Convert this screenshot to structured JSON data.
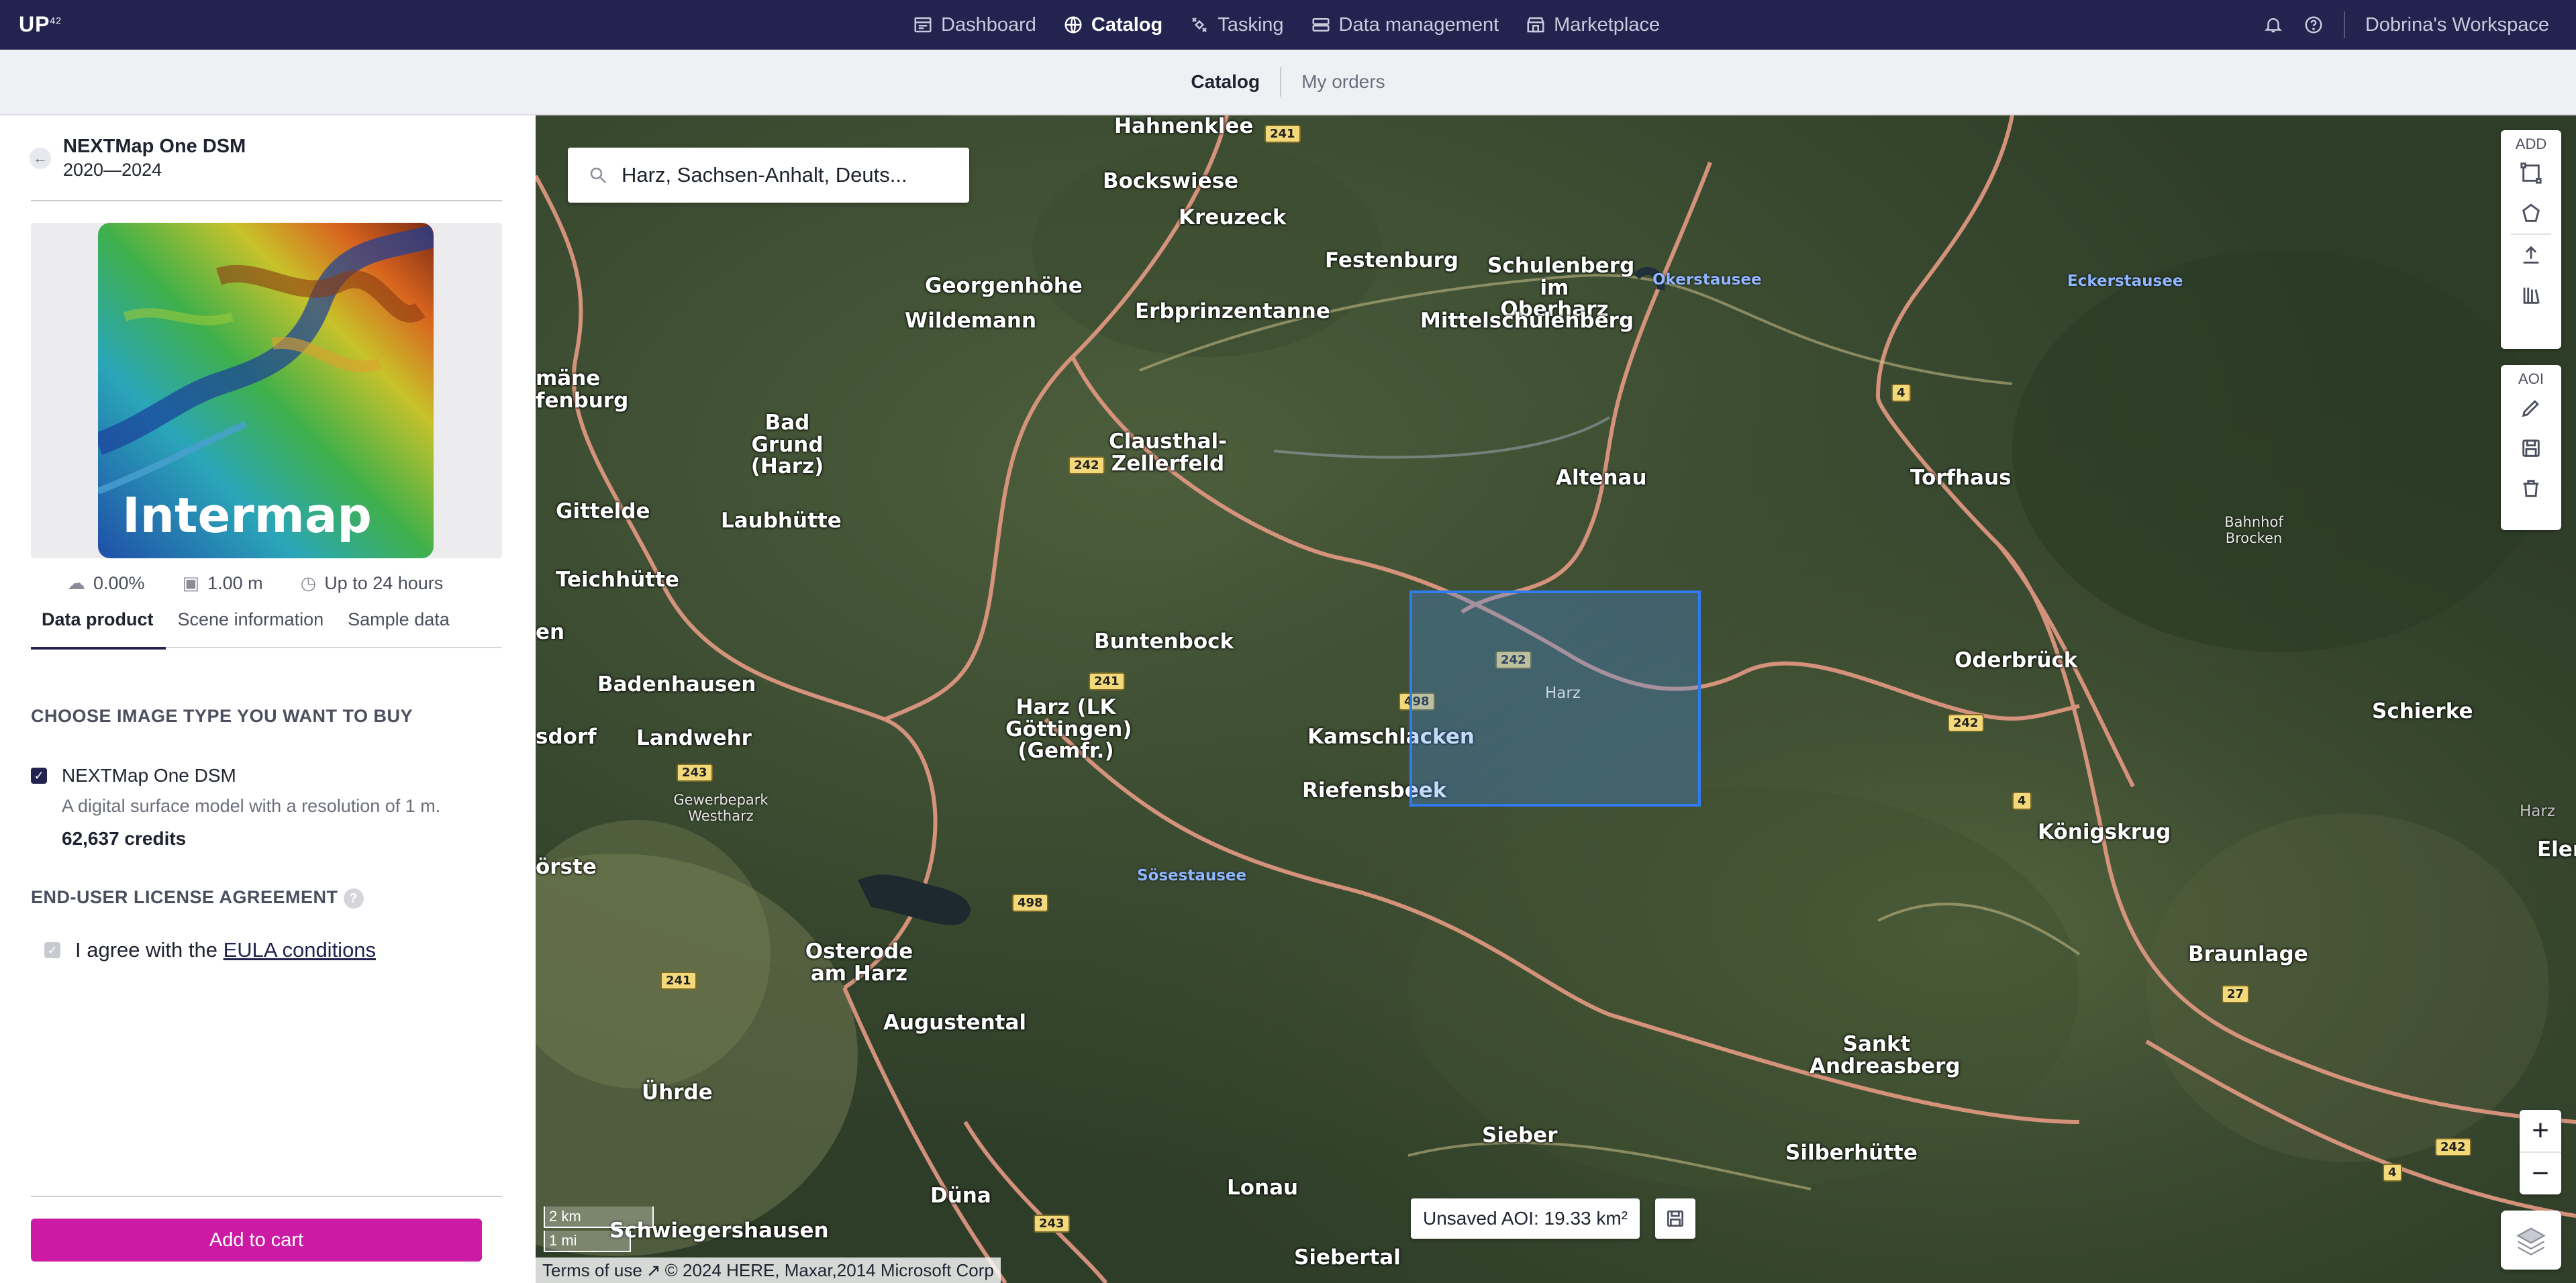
{
  "topbar": {
    "logo": "UP",
    "logo_sup": "42",
    "nav": [
      {
        "label": "Dashboard",
        "icon": "dashboard-icon"
      },
      {
        "label": "Catalog",
        "icon": "globe-icon",
        "active": true
      },
      {
        "label": "Tasking",
        "icon": "satellite-icon"
      },
      {
        "label": "Data management",
        "icon": "storage-icon"
      },
      {
        "label": "Marketplace",
        "icon": "store-icon"
      }
    ],
    "workspace": "Dobrina's Workspace"
  },
  "subnav": {
    "catalog": "Catalog",
    "orders": "My orders"
  },
  "panel": {
    "title": "NEXTMap One DSM",
    "years": "2020—2024",
    "thumb_label": "Intermap",
    "meta": {
      "cloud": "0.00%",
      "resolution": "1.00 m",
      "delivery": "Up to 24 hours"
    },
    "tabs": [
      "Data product",
      "Scene information",
      "Sample data"
    ],
    "choose_heading": "CHOOSE IMAGE TYPE YOU WANT TO BUY",
    "product_name": "NEXTMap One DSM",
    "product_desc": "A digital surface model with a resolution of 1 m.",
    "credits": "62,637 credits",
    "eula_heading": "END-USER LICENSE AGREEMENT",
    "eula_help": "?",
    "eula_prefix": "I agree with the ",
    "eula_link": "EULA conditions",
    "add_to_cart": "Add to cart"
  },
  "map": {
    "search_value": "Harz, Sachsen-Anhalt, Deuts...",
    "tools": {
      "add_label": "ADD",
      "aoi_label": "AOI"
    },
    "zoom_in": "+",
    "zoom_out": "−",
    "aoi_badge": "Unsaved AOI: 19.33 km²",
    "scale_km": "2 km",
    "scale_mi": "1 mi",
    "attribution_terms": "Terms of use",
    "attribution_text": "© 2024 HERE, Maxar,2014 Microsoft Corp",
    "aoi_name": "Harz",
    "places": [
      "Hahnenklee",
      "Bockswiese",
      "Kreuzeck",
      "Georgenhöhe",
      "Wildemann",
      "Festenburg",
      "Erbprinzentanne",
      "Schulenberg im Oberharz",
      "Mittelschulenberg",
      "Bad Grund (Harz)",
      "Clausthal-Zellerfeld",
      "Altenau",
      "Torfhaus",
      "Gittelde",
      "Laubhütte",
      "Teichhütte",
      "Buntenbock",
      "Oderbrück",
      "Schierke",
      "Badenhausen",
      "Harz (LK Göttingen) (Gemfr.)",
      "Kamschlacken",
      "Landwehr",
      "Riefensbeek",
      "Königskrug",
      "Elend",
      "Osterode am Harz",
      "Augustental",
      "Braunlage",
      "Sankt Andreasberg",
      "Ührde",
      "Sieber",
      "Silberhütte",
      "Lonau",
      "Düna",
      "Schwiegershausen",
      "Siebertal",
      "mäne fenburg",
      "sdorf",
      "örste",
      "en"
    ],
    "waters": [
      "Okerstausee",
      "Eckerstausee",
      "Sösestausee"
    ],
    "small_labels": [
      "Gewerbepark Westharz",
      "Bahnhof Brocken",
      "Harz"
    ],
    "roads": [
      "241",
      "242",
      "241",
      "243",
      "498",
      "4",
      "242",
      "4",
      "27",
      "243",
      "241",
      "498",
      "242",
      "4",
      "242"
    ]
  }
}
